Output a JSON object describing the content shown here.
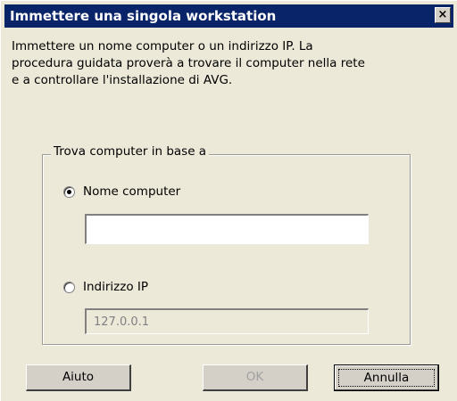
{
  "window": {
    "title": "Immettere una singola workstation",
    "close_glyph": "×"
  },
  "intro": "Immettere un nome computer o un indirizzo IP. La\nprocedura guidata proverà a trovare il computer nella rete\ne a controllare l'installazione di AVG.",
  "group": {
    "legend": "Trova computer in base a",
    "options": [
      {
        "label": "Nome computer",
        "checked": true
      },
      {
        "label": "Indirizzo IP",
        "checked": false
      }
    ],
    "computer_name": {
      "value": ""
    },
    "ip_address": {
      "value": "127.0.0.1"
    }
  },
  "buttons": {
    "help": "Aiuto",
    "ok": "OK",
    "cancel": "Annulla"
  }
}
